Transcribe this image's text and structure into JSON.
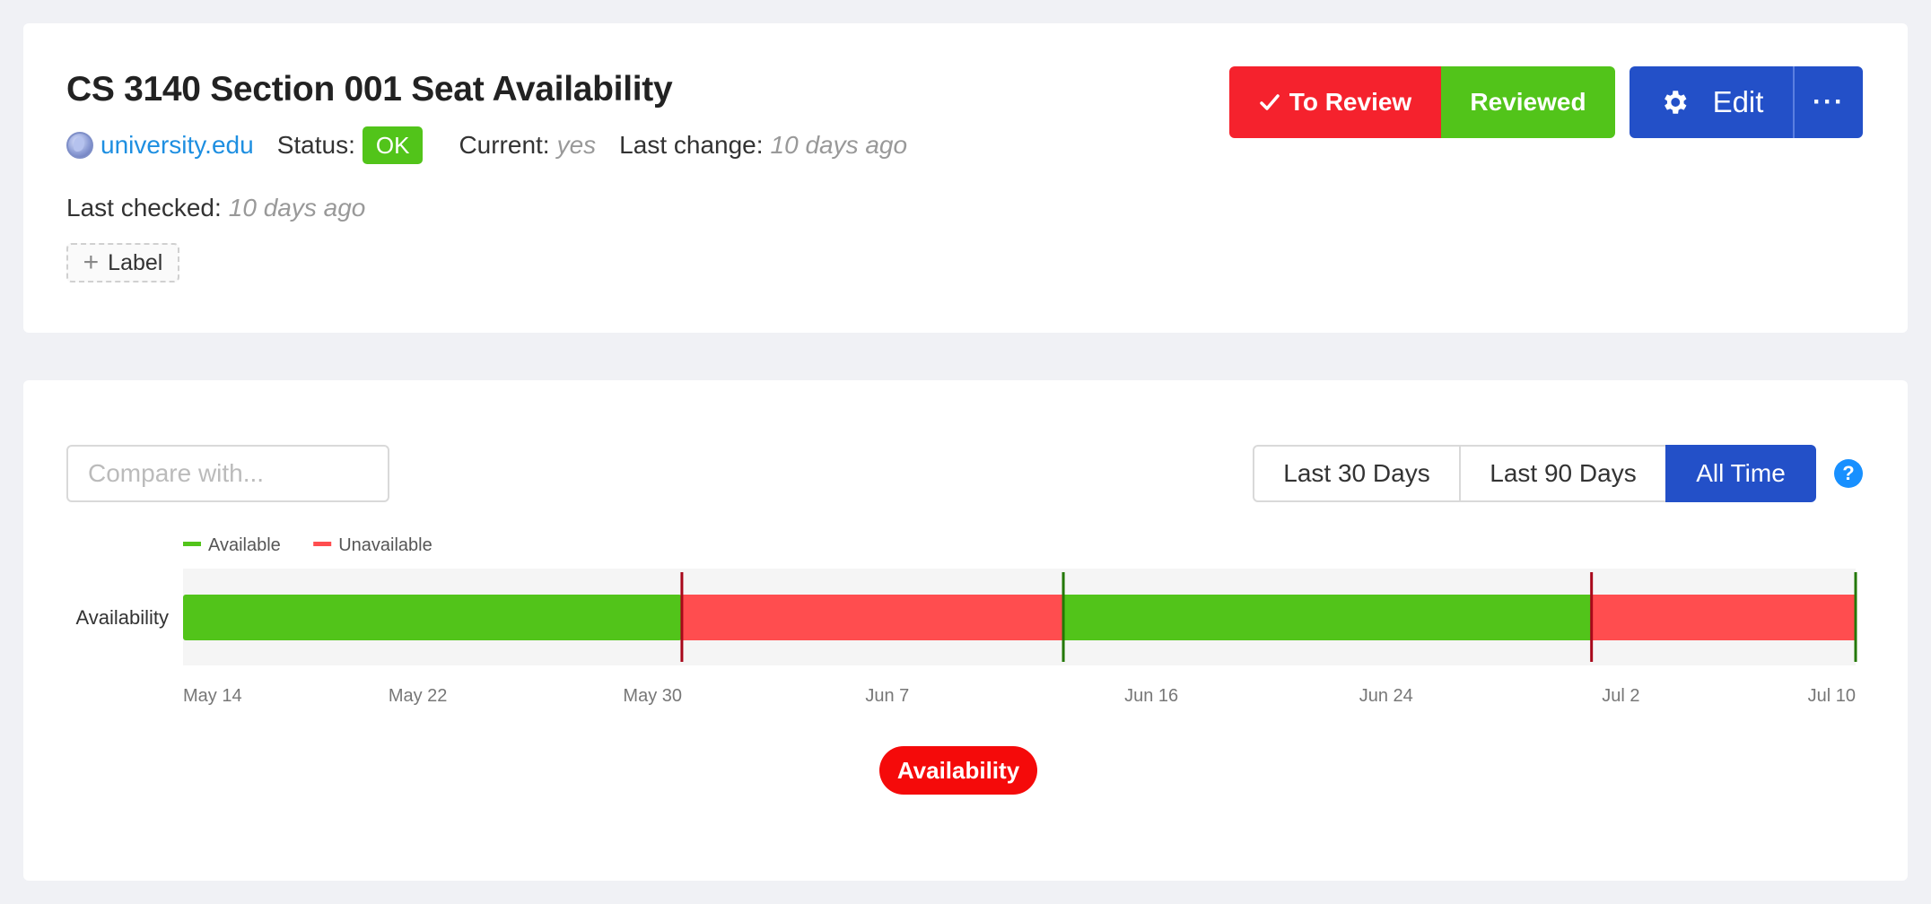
{
  "header": {
    "title": "CS 3140 Section 001 Seat Availability",
    "site": "university.edu",
    "status_label": "Status:",
    "status_value": "OK",
    "current_label": "Current:",
    "current_value": "yes",
    "last_change_label": "Last change:",
    "last_change_value": "10 days ago",
    "last_checked_label": "Last checked:",
    "last_checked_value": "10 days ago",
    "add_label_text": "Label"
  },
  "actions": {
    "to_review": "To Review",
    "reviewed": "Reviewed",
    "edit": "Edit",
    "more": "···"
  },
  "controls": {
    "compare_placeholder": "Compare with...",
    "ranges": [
      "Last 30 Days",
      "Last 90 Days",
      "All Time"
    ],
    "active_range": "All Time",
    "help": "?"
  },
  "colors": {
    "available": "#52c41a",
    "unavailable": "#ff4d4f",
    "available_marker": "#237804",
    "unavailable_marker": "#a8071a",
    "accent": "#2350c8"
  },
  "chart_data": {
    "type": "timeline",
    "xlabel": "",
    "ylabel": "",
    "row_label": "Availability",
    "x_range": [
      "2025-05-14",
      "2025-07-10"
    ],
    "x_ticks": [
      "May 14",
      "May 22",
      "May 30",
      "Jun 7",
      "Jun 16",
      "Jun 24",
      "Jul 2",
      "Jul 10"
    ],
    "x_tick_dates": [
      "2025-05-14",
      "2025-05-22",
      "2025-05-30",
      "2025-06-07",
      "2025-06-16",
      "2025-06-24",
      "2025-07-02",
      "2025-07-10"
    ],
    "legend": [
      {
        "name": "Available",
        "color": "#52c41a"
      },
      {
        "name": "Unavailable",
        "color": "#ff4d4f"
      }
    ],
    "segments": [
      {
        "state": "Available",
        "start": "2025-05-14",
        "end": "2025-05-31"
      },
      {
        "state": "Unavailable",
        "start": "2025-05-31",
        "end": "2025-06-13"
      },
      {
        "state": "Available",
        "start": "2025-06-13",
        "end": "2025-07-01"
      },
      {
        "state": "Unavailable",
        "start": "2025-07-01",
        "end": "2025-07-10"
      }
    ],
    "change_markers": [
      {
        "date": "2025-05-31",
        "state": "Unavailable"
      },
      {
        "date": "2025-06-13",
        "state": "Available"
      },
      {
        "date": "2025-07-01",
        "state": "Unavailable"
      },
      {
        "date": "2025-07-10",
        "state": "Available"
      }
    ],
    "series_toggle": "Availability",
    "grid": false,
    "legend_position": "top-left"
  }
}
